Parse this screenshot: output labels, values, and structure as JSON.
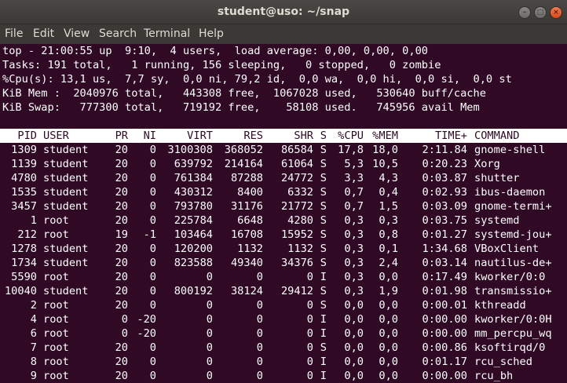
{
  "window": {
    "title": "student@uso: ~/snap",
    "buttons": {
      "minimize": "–",
      "maximize": "□",
      "close": "×"
    }
  },
  "menu": [
    "File",
    "Edit",
    "View",
    "Search",
    "Terminal",
    "Help"
  ],
  "summary": [
    "top - 21:00:55 up  9:10,  4 users,  load average: 0,00, 0,00, 0,00",
    "Tasks: 191 total,   1 running, 156 sleeping,   0 stopped,   0 zombie",
    "%Cpu(s): 13,1 us,  7,7 sy,  0,0 ni, 79,2 id,  0,0 wa,  0,0 hi,  0,0 si,  0,0 st",
    "KiB Mem :  2040976 total,   443308 free,  1067028 used,   530640 buff/cache",
    "KiB Swap:   777300 total,   719192 free,    58108 used.   745956 avail Mem"
  ],
  "columns": [
    "PID",
    "USER",
    "PR",
    "NI",
    "VIRT",
    "RES",
    "SHR",
    "S",
    "%CPU",
    "%MEM",
    "TIME+",
    "COMMAND"
  ],
  "processes": [
    [
      "1309",
      "student",
      "20",
      "0",
      "3100308",
      "368052",
      "86584",
      "S",
      "17,8",
      "18,0",
      "2:11.84",
      "gnome-shell"
    ],
    [
      "1139",
      "student",
      "20",
      "0",
      "639792",
      "214164",
      "61064",
      "S",
      "5,3",
      "10,5",
      "0:20.23",
      "Xorg"
    ],
    [
      "4780",
      "student",
      "20",
      "0",
      "761384",
      "87288",
      "24772",
      "S",
      "3,3",
      "4,3",
      "0:03.87",
      "shutter"
    ],
    [
      "1535",
      "student",
      "20",
      "0",
      "430312",
      "8400",
      "6332",
      "S",
      "0,7",
      "0,4",
      "0:02.93",
      "ibus-daemon"
    ],
    [
      "3457",
      "student",
      "20",
      "0",
      "793780",
      "31176",
      "21772",
      "S",
      "0,7",
      "1,5",
      "0:03.09",
      "gnome-termi+"
    ],
    [
      "1",
      "root",
      "20",
      "0",
      "225784",
      "6648",
      "4280",
      "S",
      "0,3",
      "0,3",
      "0:03.75",
      "systemd"
    ],
    [
      "212",
      "root",
      "19",
      "-1",
      "103464",
      "16708",
      "15952",
      "S",
      "0,3",
      "0,8",
      "0:01.27",
      "systemd-jou+"
    ],
    [
      "1278",
      "student",
      "20",
      "0",
      "120200",
      "1132",
      "1132",
      "S",
      "0,3",
      "0,1",
      "1:34.68",
      "VBoxClient"
    ],
    [
      "1734",
      "student",
      "20",
      "0",
      "823588",
      "49340",
      "34376",
      "S",
      "0,3",
      "2,4",
      "0:03.14",
      "nautilus-de+"
    ],
    [
      "5590",
      "root",
      "20",
      "0",
      "0",
      "0",
      "0",
      "I",
      "0,3",
      "0,0",
      "0:17.49",
      "kworker/0:0"
    ],
    [
      "10040",
      "student",
      "20",
      "0",
      "800192",
      "38124",
      "29412",
      "S",
      "0,3",
      "1,9",
      "0:01.98",
      "transmissio+"
    ],
    [
      "2",
      "root",
      "20",
      "0",
      "0",
      "0",
      "0",
      "S",
      "0,0",
      "0,0",
      "0:00.01",
      "kthreadd"
    ],
    [
      "4",
      "root",
      "0",
      "-20",
      "0",
      "0",
      "0",
      "I",
      "0,0",
      "0,0",
      "0:00.00",
      "kworker/0:0H"
    ],
    [
      "6",
      "root",
      "0",
      "-20",
      "0",
      "0",
      "0",
      "I",
      "0,0",
      "0,0",
      "0:00.00",
      "mm_percpu_wq"
    ],
    [
      "7",
      "root",
      "20",
      "0",
      "0",
      "0",
      "0",
      "S",
      "0,0",
      "0,0",
      "0:00.86",
      "ksoftirqd/0"
    ],
    [
      "8",
      "root",
      "20",
      "0",
      "0",
      "0",
      "0",
      "I",
      "0,0",
      "0,0",
      "0:01.17",
      "rcu_sched"
    ],
    [
      "9",
      "root",
      "20",
      "0",
      "0",
      "0",
      "0",
      "I",
      "0,0",
      "0,0",
      "0:00.00",
      "rcu_bh"
    ]
  ]
}
